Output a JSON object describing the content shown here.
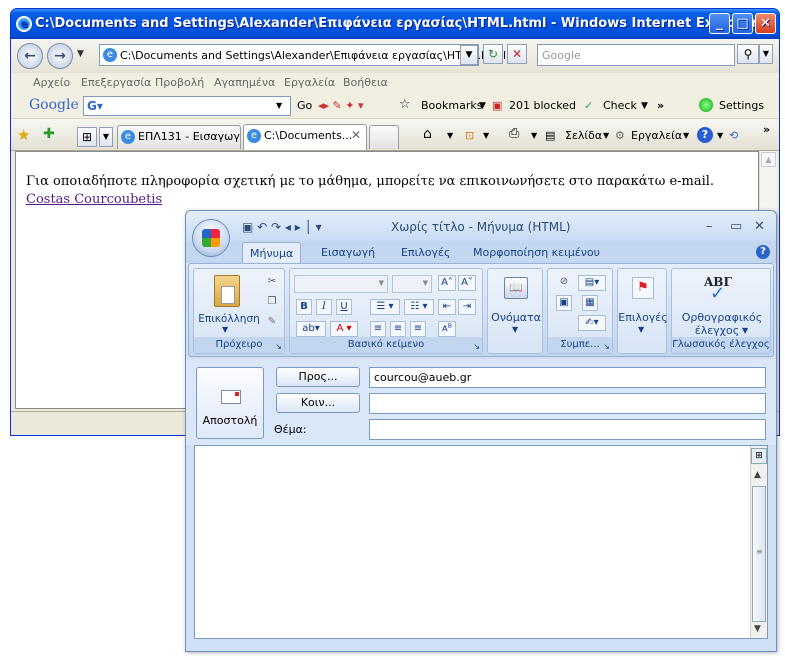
{
  "ie": {
    "title": "C:\\Documents and Settings\\Alexander\\Επιφάνεια εργασίας\\HTML.html - Windows Internet Explorer",
    "address": "C:\\Documents and Settings\\Alexander\\Επιφάνεια εργασίας\\HTML.html",
    "search_placeholder": "Google",
    "menu": [
      "Αρχείο",
      "Επεξεργασία",
      "Προβολή",
      "Αγαπημένα",
      "Εργαλεία",
      "Βοήθεια"
    ],
    "google_bar": {
      "logo": "Google",
      "go": "Go",
      "bookmarks": "Bookmarks",
      "blocked": "201 blocked",
      "check": "Check",
      "settings": "Settings"
    },
    "tabs": [
      {
        "label": "ΕΠΛ131 - Εισαγωγ..."
      },
      {
        "label": "C:\\Documents..."
      }
    ],
    "toolbar": {
      "page": "Σελίδα",
      "tools": "Εργαλεία"
    },
    "content": {
      "message": "Για οποιαδήποτε πληροφορία σχετική με το μάθημα, μπορείτε να επικοινωνήσετε στο παρακάτω e-mail.",
      "link": "Costas Courcoubetis"
    }
  },
  "outlook": {
    "title": "Χωρίς τίτλο - Μήνυμα (HTML)",
    "ribbon_tabs": [
      "Μήνυμα",
      "Εισαγωγή",
      "Επιλογές",
      "Μορφοποίηση κειμένου"
    ],
    "groups": {
      "clipboard": {
        "label": "Πρόχειρο",
        "paste": "Επικόλληση"
      },
      "basic_text": {
        "label": "Βασικό κείμενο"
      },
      "names": {
        "label": "Ονόματα"
      },
      "include": {
        "label": "Συμπε..."
      },
      "options": {
        "label": "Επιλογές"
      },
      "proofing": {
        "label": "Γλωσσικός έλεγχος",
        "spelling_line1": "Ορθογραφικός",
        "spelling_line2": "έλεγχος",
        "abc": "ABΓ"
      }
    },
    "fields": {
      "send": "Αποστολή",
      "to_button": "Προς...",
      "cc_button": "Κοιν...",
      "subject_label": "Θέμα:",
      "to_value": "courcou@aueb.gr",
      "cc_value": "",
      "subject_value": ""
    }
  },
  "colors": {
    "xp_title_blue": "#0054e3",
    "link_visited": "#551a8b",
    "ribbon_text": "#15428b"
  }
}
